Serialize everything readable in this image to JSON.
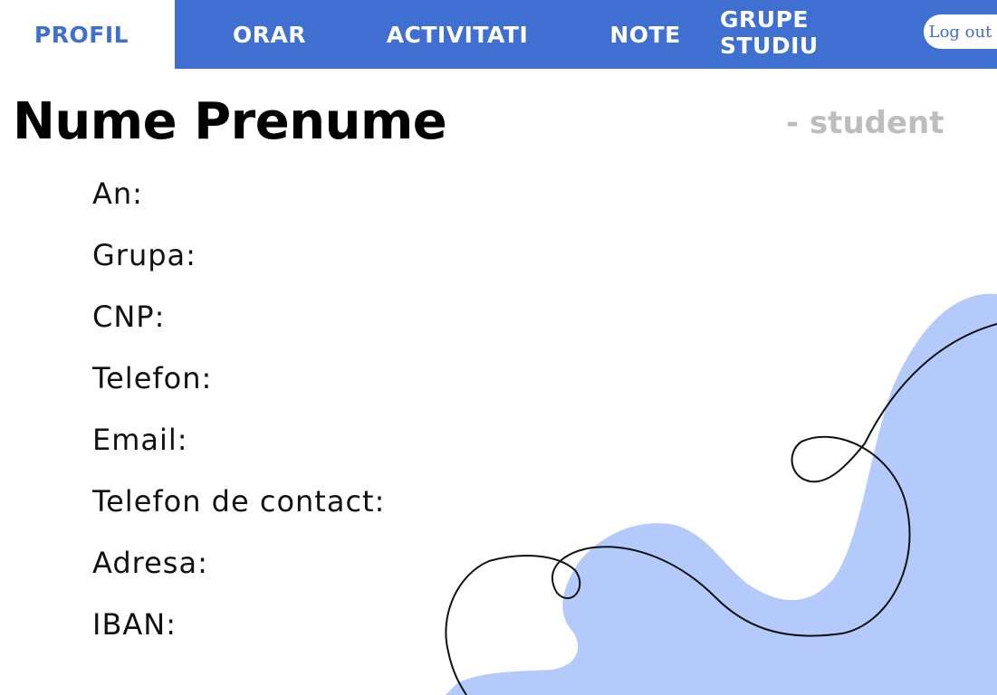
{
  "nav": {
    "tabs": [
      {
        "label": "PROFIL",
        "active": true
      },
      {
        "label": "ORAR",
        "active": false
      },
      {
        "label": "ACTIVITATI",
        "active": false
      },
      {
        "label": "NOTE",
        "active": false
      },
      {
        "label": "GRUPE STUDIU",
        "active": false
      }
    ],
    "logout_label": "Log out"
  },
  "profile": {
    "name": "Nume Prenume",
    "role": "- student",
    "fields": [
      {
        "label": "An:"
      },
      {
        "label": "Grupa:"
      },
      {
        "label": "CNP:"
      },
      {
        "label": "Telefon:"
      },
      {
        "label": "Email:"
      },
      {
        "label": "Telefon de contact:"
      },
      {
        "label": "Adresa:"
      },
      {
        "label": "IBAN:"
      }
    ]
  },
  "colors": {
    "accent": "#3f6fd1",
    "blob": "#b4cafa",
    "role_text": "#bdbdbd"
  }
}
